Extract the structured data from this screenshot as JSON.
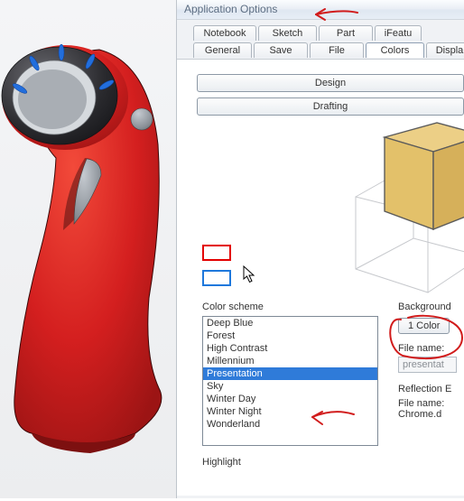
{
  "dialog": {
    "title": "Application Options",
    "tabs_row1": [
      "Notebook",
      "Sketch",
      "Part",
      "iFeatu"
    ],
    "tabs_row2": [
      "General",
      "Save",
      "File",
      "Colors",
      "Displa"
    ],
    "active_tab": "Colors"
  },
  "buttons": {
    "design": "Design",
    "drafting": "Drafting"
  },
  "color_scheme": {
    "label": "Color scheme",
    "items": [
      "Deep Blue",
      "Forest",
      "High Contrast",
      "Millennium",
      "Presentation",
      "Sky",
      "Winter Day",
      "Winter Night",
      "Wonderland"
    ],
    "selected_index": 4
  },
  "background": {
    "label": "Background",
    "button": "1 Color",
    "file_label": "File name:",
    "file_value": "presentat"
  },
  "reflection": {
    "label": "Reflection E",
    "file_label": "File name:",
    "file_value": "Chrome.d"
  },
  "highlight": {
    "label": "Highlight"
  },
  "swatches": {
    "red": "#e30000",
    "blue": "#1e78dc"
  },
  "cube": {
    "fill": "#e3c16a",
    "wire": "#5b5b5b",
    "ghost": "#c7c9cd"
  },
  "model_colors": {
    "body": "#d41f1f",
    "body_hl": "#f24a3a",
    "ring": "#2a2a2e",
    "ring_hl": "#5b5b60",
    "trigger_clip": "#8c9299",
    "trigger_clip_hl": "#b8bdc3",
    "led": "#226edc"
  },
  "annotation_color": "#d11c1c"
}
